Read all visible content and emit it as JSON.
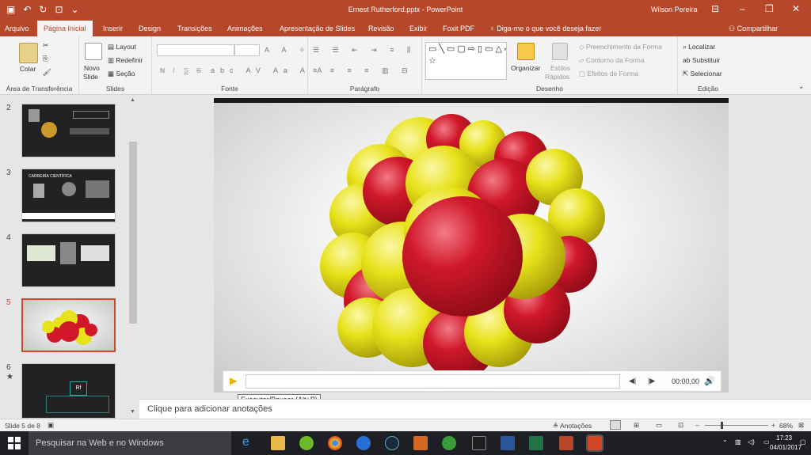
{
  "window": {
    "title": "Ernest Rutherford.pptx  -  PowerPoint",
    "user": "Wilson Pereira"
  },
  "tabs": [
    "Arquivo",
    "Página Inicial",
    "Inserir",
    "Design",
    "Transições",
    "Animações",
    "Apresentação de Slides",
    "Revisão",
    "Exibir",
    "Foxit PDF"
  ],
  "active_tab": "Página Inicial",
  "tell_me": "Diga-me o que você deseja fazer",
  "share": "Compartilhar",
  "ribbon": {
    "clipboard": {
      "paste": "Colar",
      "label": "Área de Transferência"
    },
    "slides": {
      "new_slide_1": "Novo",
      "new_slide_2": "Slide",
      "layout": "Layout",
      "reset": "Redefinir",
      "section": "Seção",
      "label": "Slides"
    },
    "font": {
      "label": "Fonte",
      "bold": "N",
      "italic": "I",
      "underline": "S",
      "strike": "S"
    },
    "paragraph": {
      "label": "Parágrafo"
    },
    "drawing": {
      "arrange": "Organizar",
      "styles_1": "Estilos",
      "styles_2": "Rápidos",
      "fill": "Preenchimento da Forma",
      "outline": "Contorno da Forma",
      "effects": "Efeitos de Forma",
      "label": "Desenho"
    },
    "editing": {
      "find": "Localizar",
      "replace": "Substituir",
      "select": "Selecionar",
      "label": "Edição"
    }
  },
  "thumbnails": [
    {
      "num": "2",
      "star": ""
    },
    {
      "num": "3",
      "star": "",
      "caption": "CARREIRA CIENTÍFICA"
    },
    {
      "num": "4",
      "star": ""
    },
    {
      "num": "5",
      "star": "",
      "selected": true
    },
    {
      "num": "6",
      "star": "★"
    }
  ],
  "player": {
    "time": "00:00,00"
  },
  "tooltip": "Executar/Pausar (Alt+P)",
  "notes_placeholder": "Clique para adicionar anotações",
  "status": {
    "slide": "Slide 5 de 8",
    "notes": "Anotações",
    "zoom": "68%"
  },
  "taskbar": {
    "search": "Pesquisar na Web e no Windows",
    "time": "17:23",
    "date": "04/01/2017"
  },
  "colors": {
    "accent": "#b7472a",
    "red_ball": "#d0182a",
    "yellow_ball": "#e8e21a"
  }
}
